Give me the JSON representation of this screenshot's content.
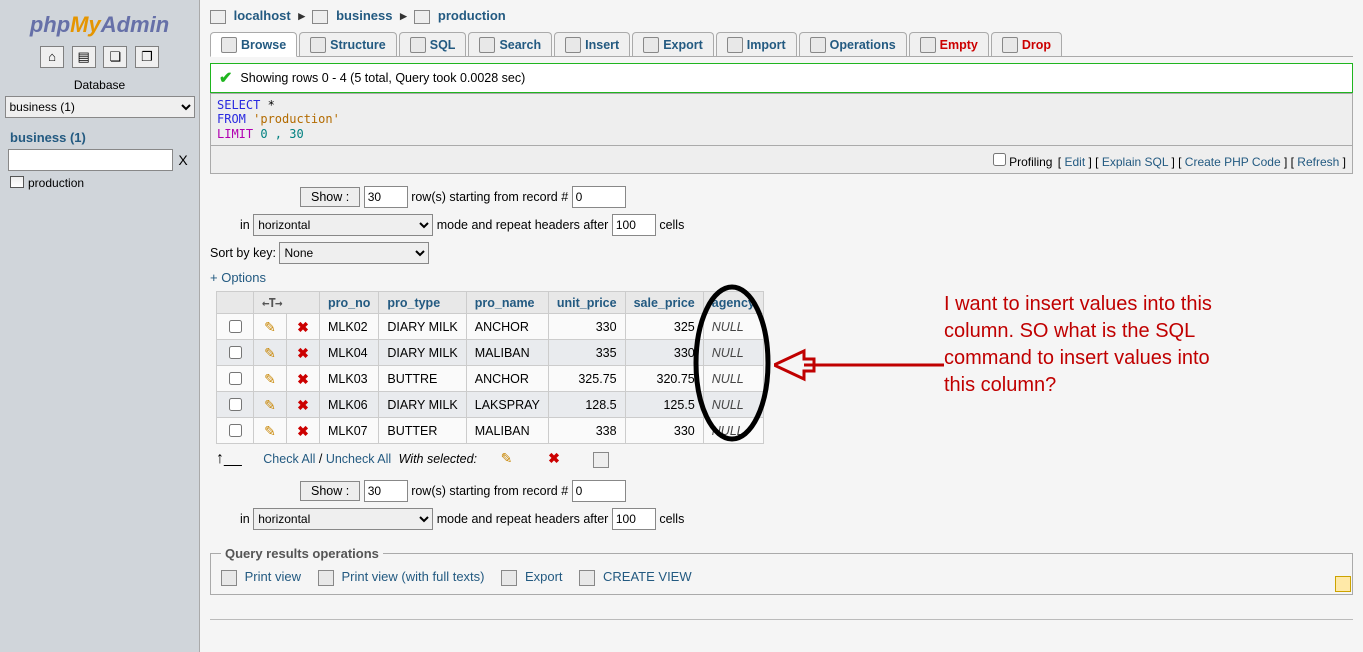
{
  "logo": {
    "p1": "php",
    "p2": "My",
    "p3": "Admin"
  },
  "sidebar": {
    "database_label": "Database",
    "db_options": [
      "business (1)"
    ],
    "db_link": "business (1)",
    "filter_placeholder": "",
    "clear": "X",
    "tables": [
      "production"
    ]
  },
  "breadcrumb": {
    "server": "localhost",
    "database": "business",
    "table": "production"
  },
  "tabs": [
    {
      "id": "browse",
      "label": "Browse",
      "active": true
    },
    {
      "id": "structure",
      "label": "Structure"
    },
    {
      "id": "sql",
      "label": "SQL"
    },
    {
      "id": "search",
      "label": "Search"
    },
    {
      "id": "insert",
      "label": "Insert"
    },
    {
      "id": "export",
      "label": "Export"
    },
    {
      "id": "import",
      "label": "Import"
    },
    {
      "id": "operations",
      "label": "Operations"
    },
    {
      "id": "empty",
      "label": "Empty",
      "red": true
    },
    {
      "id": "drop",
      "label": "Drop",
      "red": true
    }
  ],
  "success": "Showing rows 0 - 4 (5 total, Query took 0.0028 sec)",
  "sql": {
    "select": "SELECT",
    "star": " *",
    "from": "FROM",
    "table": " 'production'",
    "limit": "LIMIT",
    "nums": " 0 , 30"
  },
  "sql_links": {
    "profiling_label": "Profiling",
    "edit": "Edit",
    "explain": "Explain SQL",
    "create_php": "Create PHP Code",
    "refresh": "Refresh"
  },
  "show": {
    "button": "Show :",
    "rows": "30",
    "rows_text": "row(s) starting from record #",
    "start": "0",
    "in_text": "in",
    "mode_options": [
      "horizontal"
    ],
    "repeat_text": "mode and repeat headers after",
    "repeat": "100",
    "cells": "cells"
  },
  "sort": {
    "label": "Sort by key:",
    "options": [
      "None"
    ]
  },
  "options_link": "+ Options",
  "table": {
    "arrow_col": "←T→",
    "columns": [
      "pro_no",
      "pro_type",
      "pro_name",
      "unit_price",
      "sale_price",
      "agency"
    ],
    "rows": [
      {
        "pro_no": "MLK02",
        "pro_type": "DIARY MILK",
        "pro_name": "ANCHOR",
        "unit_price": "330",
        "sale_price": "325",
        "agency": "NULL"
      },
      {
        "pro_no": "MLK04",
        "pro_type": "DIARY MILK",
        "pro_name": "MALIBAN",
        "unit_price": "335",
        "sale_price": "330",
        "agency": "NULL"
      },
      {
        "pro_no": "MLK03",
        "pro_type": "BUTTRE",
        "pro_name": "ANCHOR",
        "unit_price": "325.75",
        "sale_price": "320.75",
        "agency": "NULL"
      },
      {
        "pro_no": "MLK06",
        "pro_type": "DIARY MILK",
        "pro_name": "LAKSPRAY",
        "unit_price": "128.5",
        "sale_price": "125.5",
        "agency": "NULL"
      },
      {
        "pro_no": "MLK07",
        "pro_type": "BUTTER",
        "pro_name": "MALIBAN",
        "unit_price": "338",
        "sale_price": "330",
        "agency": "NULL"
      }
    ]
  },
  "under_table": {
    "check_all": "Check All",
    "sep": " / ",
    "uncheck_all": "Uncheck All",
    "with_selected": "With selected:"
  },
  "ops": {
    "legend": "Query results operations",
    "print": "Print view",
    "print_full": "Print view (with full texts)",
    "export": "Export",
    "create_view": "CREATE VIEW"
  },
  "annotation": "I want to insert values into this column. SO what is the SQL command to insert values into this column?"
}
